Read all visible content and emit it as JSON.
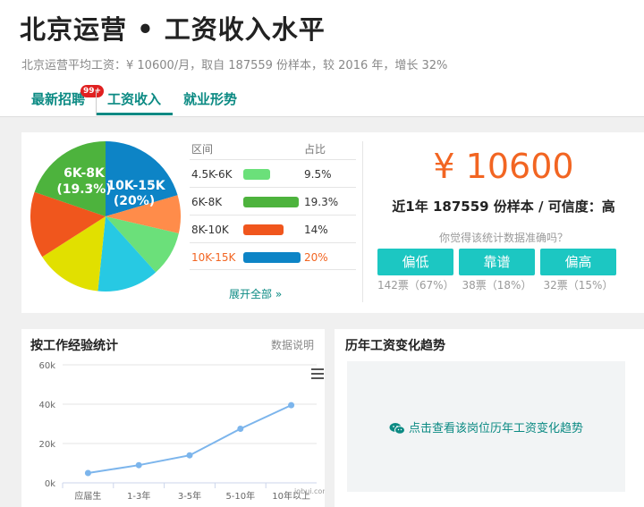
{
  "header": {
    "title": "北京运营 • 工资收入水平",
    "subtitle": "北京运营平均工资：¥ 10600/月，取自 187559 份样本，较 2016 年，增长 32%",
    "tabs": [
      {
        "label": "最新招聘",
        "badge": "99+"
      },
      {
        "label": "工资收入",
        "active": true
      },
      {
        "label": "就业形势"
      }
    ]
  },
  "distribution": {
    "col_range": "区间",
    "col_ratio": "占比",
    "rows": [
      {
        "range": "4.5K-6K",
        "ratio": "9.5%",
        "value": 9.5,
        "color": "#6be07a"
      },
      {
        "range": "6K-8K",
        "ratio": "19.3%",
        "value": 19.3,
        "color": "#4db33d"
      },
      {
        "range": "8K-10K",
        "ratio": "14%",
        "value": 14,
        "color": "#f0561d"
      },
      {
        "range": "10K-15K",
        "ratio": "20%",
        "value": 20,
        "color": "#0d84c6",
        "highlight": true
      }
    ],
    "expand_label": "展开全部 »",
    "pie_labels": [
      {
        "text": "6K-8K",
        "sub": "(19.3%)"
      },
      {
        "text": "10K-15K",
        "sub": "(20%)"
      }
    ]
  },
  "chart_data": {
    "type": "pie",
    "slices": [
      {
        "label": "10K-15K",
        "value": 20,
        "color": "#0d84c6"
      },
      {
        "label": "",
        "value": 8,
        "color": "#ff8c4a"
      },
      {
        "label": "4.5K-6K",
        "value": 9.5,
        "color": "#6be07a"
      },
      {
        "label": "",
        "value": 13,
        "color": "#27c9e3"
      },
      {
        "label": "",
        "value": 14,
        "color": "#e1e000"
      },
      {
        "label": "8K-10K",
        "value": 14,
        "color": "#f0561d"
      },
      {
        "label": "6K-8K",
        "value": 19.3,
        "color": "#4db33d"
      }
    ]
  },
  "salary": {
    "amount": "¥ 10600",
    "summary": "近1年 187559 份样本 / 可信度：高",
    "question": "你觉得该统计数据准确吗？",
    "votes": [
      {
        "label": "偏低",
        "count": "142票（67%）"
      },
      {
        "label": "靠谱",
        "count": "38票（18%）"
      },
      {
        "label": "偏高",
        "count": "32票（15%）"
      }
    ]
  },
  "experience": {
    "title": "按工作经验统计",
    "link": "数据说明",
    "watermark": "jobui.com",
    "chart_data": {
      "type": "line",
      "categories": [
        "应届生",
        "1-3年",
        "3-5年",
        "5-10年",
        "10年以上"
      ],
      "values": [
        5000,
        9000,
        14000,
        27500,
        39500
      ],
      "y_ticks": [
        "0k",
        "20k",
        "40k",
        "60k"
      ],
      "ylim": [
        0,
        60000
      ],
      "color": "#7cb5ec"
    }
  },
  "trend": {
    "title": "历年工资变化趋势",
    "link_label": "点击查看该岗位历年工资变化趋势"
  }
}
